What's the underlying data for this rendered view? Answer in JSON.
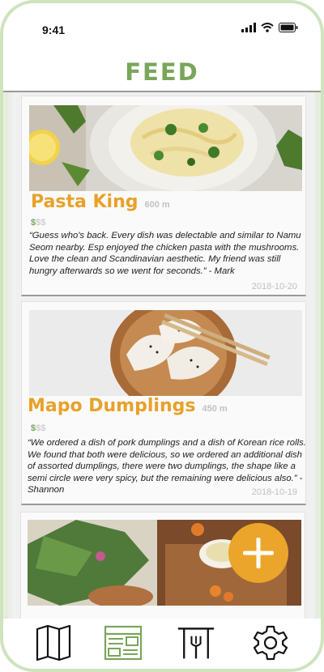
{
  "status_bar": {
    "time": "9:41"
  },
  "header": {
    "title": "FEED"
  },
  "feed": {
    "cards": [
      {
        "name": "Pasta King",
        "distance": "600 m",
        "price_on": "$",
        "price_off": "$$",
        "review": "“Guess who's back. Every dish was delectable and similar to Namu Seom nearby. Esp enjoyed the chicken pasta with the mushrooms. Love the clean and Scandinavian aesthetic. My friend was still hungry afterwards so we went for seconds.” - Mark",
        "date": "2018-10-20"
      },
      {
        "name": "Mapo Dumplings",
        "distance": "450 m",
        "price_on": "$",
        "price_off": "$$",
        "review": "“We ordered a dish of pork dumplings and a dish of Korean rice rolls. We found that both were delicious, so we ordered an additional dish of assorted dumplings, there were two dumplings, the shape like a semi circle were very spicy, but the remaining were delicious also.” - Shannon",
        "date": "2018-10-19"
      }
    ]
  },
  "tab_bar": {
    "tabs": [
      {
        "icon": "map-icon",
        "active": false
      },
      {
        "icon": "feed-icon",
        "active": true
      },
      {
        "icon": "restaurant-icon",
        "active": false
      },
      {
        "icon": "gear-icon",
        "active": false
      }
    ]
  },
  "colors": {
    "accent_green": "#79a65a",
    "accent_orange": "#e8a12a",
    "add_button": "#eba52a"
  }
}
